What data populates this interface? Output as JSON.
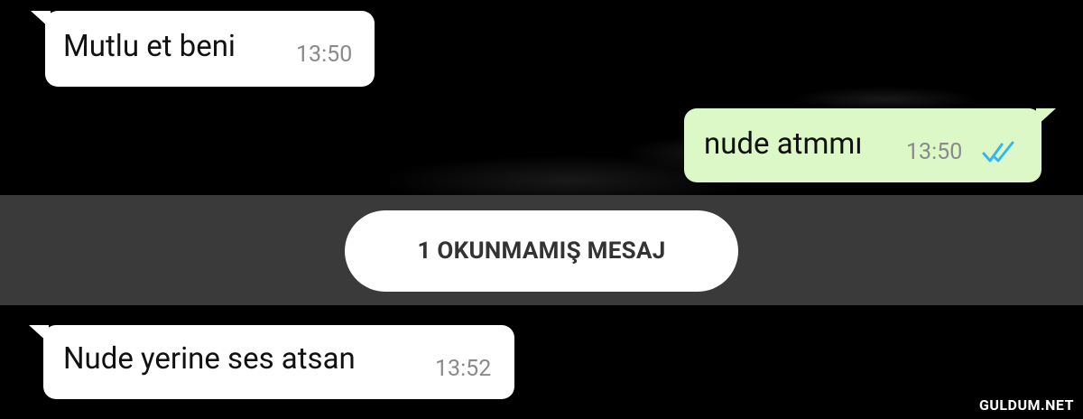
{
  "messages": [
    {
      "text": "Mutlu et beni",
      "time": "13:50",
      "direction": "incoming"
    },
    {
      "text": "nude atmmı",
      "time": "13:50",
      "direction": "outgoing",
      "status": "read"
    },
    {
      "text": "Nude yerine ses atsan",
      "time": "13:52",
      "direction": "incoming"
    }
  ],
  "unread_banner": {
    "label": "1 OKUNMAMIŞ MESAJ"
  },
  "watermark": "GULDUM.NET",
  "colors": {
    "background": "#000000",
    "incoming_bubble": "#ffffff",
    "outgoing_bubble": "#dcf8c6",
    "read_ticks": "#34b7f1",
    "unread_bar": "#3a3a3a"
  },
  "icons": {
    "read_receipt": "double-check-icon"
  }
}
